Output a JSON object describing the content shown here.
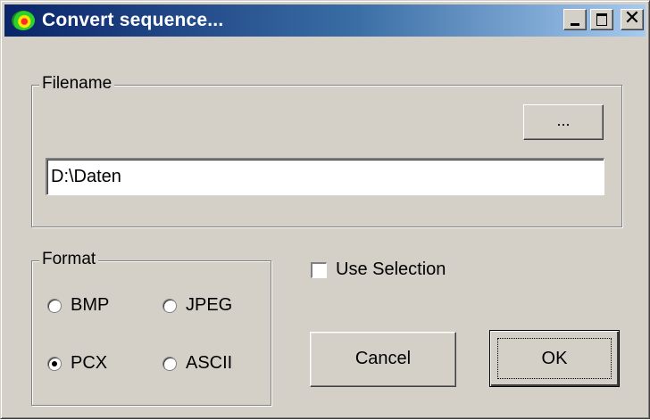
{
  "window": {
    "title": "Convert sequence...",
    "titlebar_colors": [
      "#0a246a",
      "#a6caf0"
    ],
    "icon": "app-icon",
    "controls": {
      "minimize_icon": "minimize-icon",
      "maximize_icon": "maximize-icon",
      "close_glyph": "✕"
    }
  },
  "filename": {
    "group_label": "Filename",
    "browse_label": "...",
    "value": "D:\\Daten"
  },
  "format": {
    "group_label": "Format",
    "options": [
      {
        "label": "BMP",
        "checked": false
      },
      {
        "label": "JPEG",
        "checked": false
      },
      {
        "label": "PCX",
        "checked": true
      },
      {
        "label": "ASCII",
        "checked": false
      }
    ]
  },
  "use_selection": {
    "label": "Use Selection",
    "checked": false
  },
  "buttons": {
    "cancel": "Cancel",
    "ok": "OK"
  }
}
